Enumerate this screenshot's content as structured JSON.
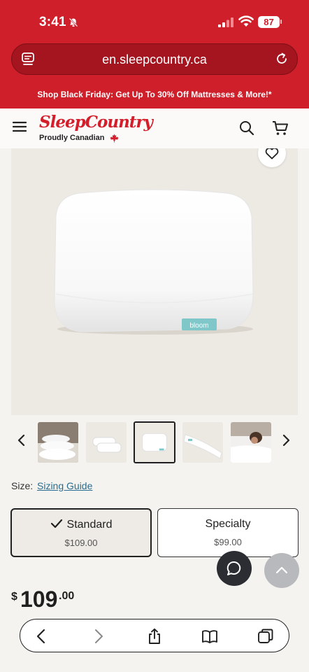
{
  "status_bar": {
    "time": "3:41",
    "battery": "87"
  },
  "browser": {
    "url": "en.sleepcountry.ca"
  },
  "promo_banner": "Shop Black Friday: Get Up To 30% Off Mattresses & More!*",
  "header": {
    "logo": "SleepCountry",
    "tagline": "Proudly Canadian"
  },
  "product": {
    "image_brand_tag": "bloom",
    "thumbnail_count": 5,
    "active_thumbnail_index": 2
  },
  "size": {
    "label": "Size:",
    "guide_link": "Sizing Guide",
    "options": [
      {
        "name": "Standard",
        "price": "$109.00",
        "selected": true
      },
      {
        "name": "Specialty",
        "price": "$99.00",
        "selected": false
      }
    ]
  },
  "price": {
    "currency": "$",
    "whole": "109",
    "cents": ".00"
  },
  "colors": {
    "brand_red": "#cf1f2a",
    "link": "#2a6c8f",
    "chat_button": "#2b2d33"
  }
}
